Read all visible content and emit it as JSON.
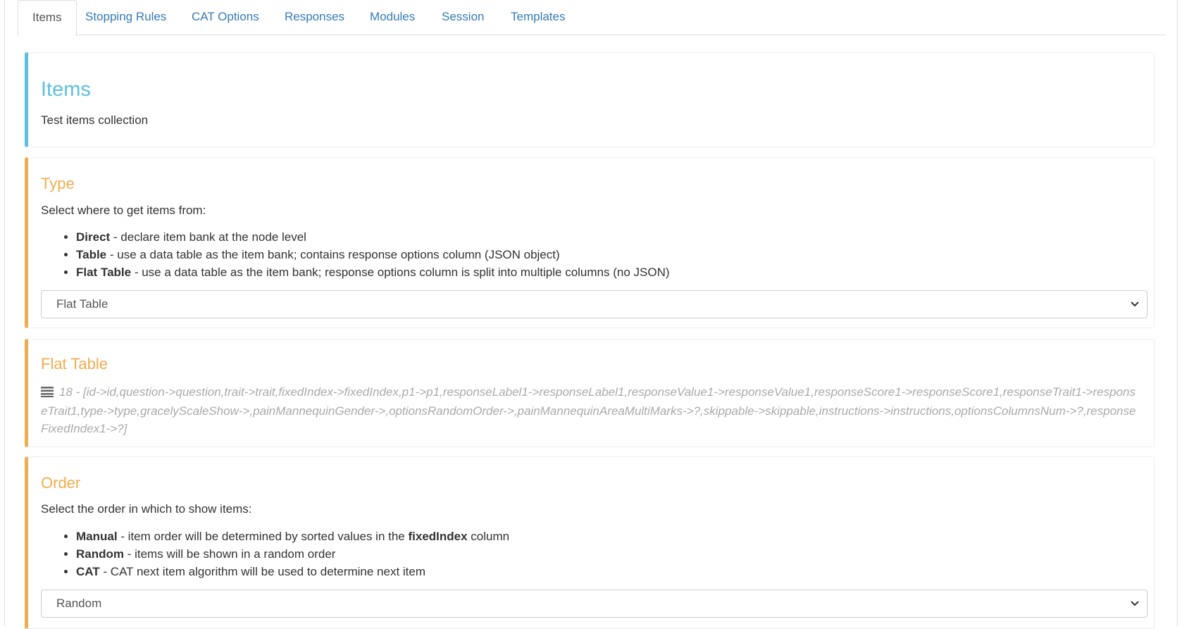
{
  "tabs": [
    "Items",
    "Stopping Rules",
    "CAT Options",
    "Responses",
    "Modules",
    "Session",
    "Templates"
  ],
  "items_panel": {
    "title": "Items",
    "subtitle": "Test items collection"
  },
  "type_panel": {
    "title": "Type",
    "intro": "Select where to get items from:",
    "options": [
      {
        "name": "Direct",
        "desc": " - declare item bank at the node level"
      },
      {
        "name": "Table",
        "desc": " - use a data table as the item bank; contains response options column (JSON object)"
      },
      {
        "name": "Flat Table",
        "desc": " - use a data table as the item bank; response options column is split into multiple columns (no JSON)"
      }
    ],
    "selected": "Flat Table"
  },
  "flat_table_panel": {
    "title": "Flat Table",
    "mapping": "18 - [id->id,question->question,trait->trait,fixedIndex->fixedIndex,p1->p1,responseLabel1->responseLabel1,responseValue1->responseValue1,responseScore1->responseScore1,responseTrait1->responseTrait1,type->type,gracelyScaleShow->,painMannequinGender->,optionsRandomOrder->,painMannequinAreaMultiMarks->?,skippable->skippable,instructions->instructions,optionsColumnsNum->?,responseFixedIndex1->?]"
  },
  "order_panel": {
    "title": "Order",
    "intro": "Select the order in which to show items:",
    "manual": {
      "name": "Manual",
      "desc": " - item order will be determined by sorted values in the ",
      "col": "fixedIndex",
      "tail": " column"
    },
    "options": [
      {
        "name": "Random",
        "desc": " - items will be shown in a random order"
      },
      {
        "name": "CAT",
        "desc": " - CAT next item algorithm will be used to determine next item"
      }
    ],
    "selected": "Random"
  },
  "colors": {
    "info": "#5bc0de",
    "warning": "#f0ad4e",
    "link": "#337ab7"
  },
  "icons": {
    "select_arrow": "chevron-down-icon",
    "mapping": "list-icon"
  }
}
